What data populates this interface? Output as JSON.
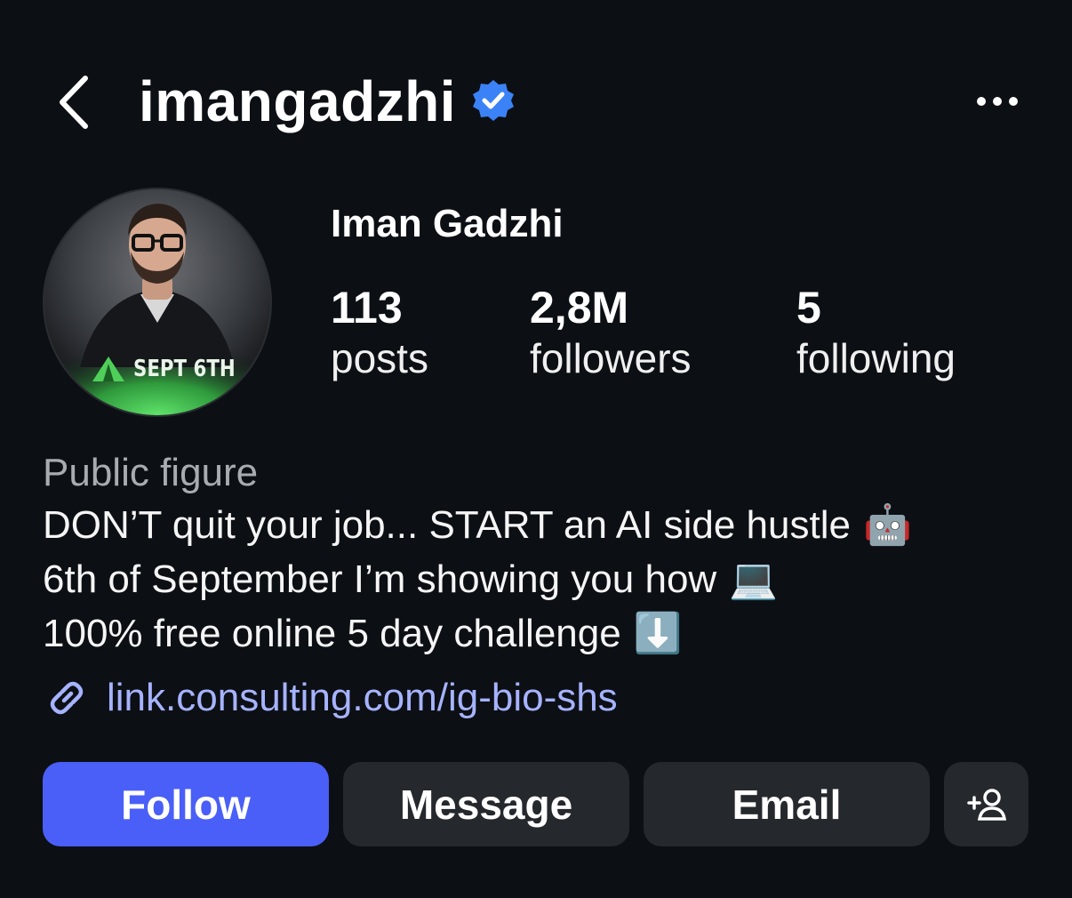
{
  "header": {
    "back_icon": "chevron-left-icon",
    "username": "imangadzhi",
    "verified_icon": "verified-badge-icon",
    "more_icon": "more-horizontal-icon"
  },
  "profile": {
    "avatar_badge_text": "SEPT 6TH",
    "display_name": "Iman Gadzhi",
    "stats": [
      {
        "value": "113",
        "label": "posts"
      },
      {
        "value": "2,8M",
        "label": "followers"
      },
      {
        "value": "5",
        "label": "following"
      }
    ]
  },
  "bio": {
    "category": "Public figure",
    "lines": [
      {
        "text": "DON’T quit your job... START an AI side hustle",
        "emoji": "🤖"
      },
      {
        "text": "6th of September I’m showing you how",
        "emoji": "💻"
      },
      {
        "text": "100% free online 5 day challenge",
        "emoji": "⬇️"
      }
    ],
    "link_icon": "link-icon",
    "link": "link.consulting.com/ig-bio-shs"
  },
  "actions": {
    "follow_label": "Follow",
    "message_label": "Message",
    "email_label": "Email",
    "add_icon": "add-person-icon"
  },
  "colors": {
    "background": "#0c0f14",
    "accent": "#4a5ff7",
    "verified": "#3b82f6",
    "link": "#a6b3ff",
    "button_dark": "#25282d",
    "avatar_ring_glow": "#3fc24f"
  }
}
